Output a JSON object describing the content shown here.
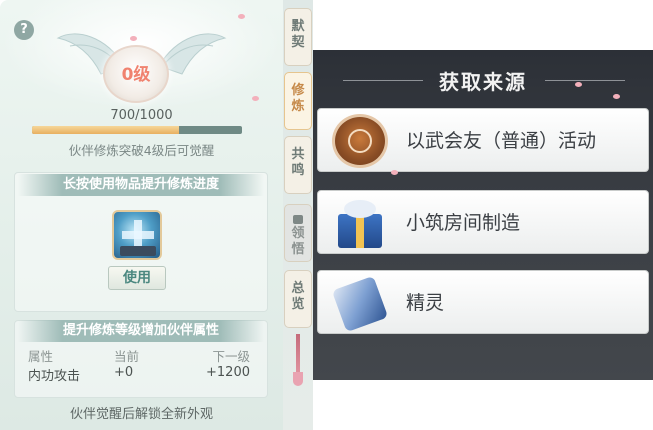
{
  "left_panel": {
    "help_icon_glyph": "?",
    "level_label": "0级",
    "progress": {
      "text": "700/1000",
      "current": 700,
      "max": 1000
    },
    "hint": "伙伴修炼突破4级后可觉醒",
    "use_section": {
      "header": "长按使用物品提升修炼进度",
      "item_icon": "blue-orb-item-icon",
      "use_button_label": "使用"
    },
    "attr_section": {
      "header": "提升修炼等级增加伙伴属性",
      "columns": [
        "属性",
        "当前",
        "下一级"
      ],
      "rows": [
        {
          "name": "内功攻击",
          "current": "+0",
          "next": "+1200"
        }
      ]
    },
    "bottom_note": "伙伴觉醒后解锁全新外观"
  },
  "side_tabs": [
    {
      "label_top": "默",
      "label_bottom": "契",
      "state": "normal"
    },
    {
      "label_top": "修",
      "label_bottom": "炼",
      "state": "active"
    },
    {
      "label_top": "共",
      "label_bottom": "鸣",
      "state": "normal"
    },
    {
      "label_top": "领",
      "label_bottom": "悟",
      "state": "locked"
    },
    {
      "label_top": "总",
      "label_bottom": "览",
      "state": "normal"
    }
  ],
  "right_panel": {
    "title": "获取来源",
    "sources": [
      {
        "label": "以武会友（普通）活动",
        "icon": "medal-icon"
      },
      {
        "label": "小筑房间制造",
        "icon": "gift-box-icon"
      },
      {
        "label": "精灵",
        "icon": "scroll-icon"
      }
    ]
  },
  "colors": {
    "level_text": "#f0826f",
    "progress_fill": "#e8b060",
    "section_header_bg": "#9fbcb8",
    "active_tab_text": "#c68a4a",
    "right_panel_bg": "#3b3f45"
  }
}
